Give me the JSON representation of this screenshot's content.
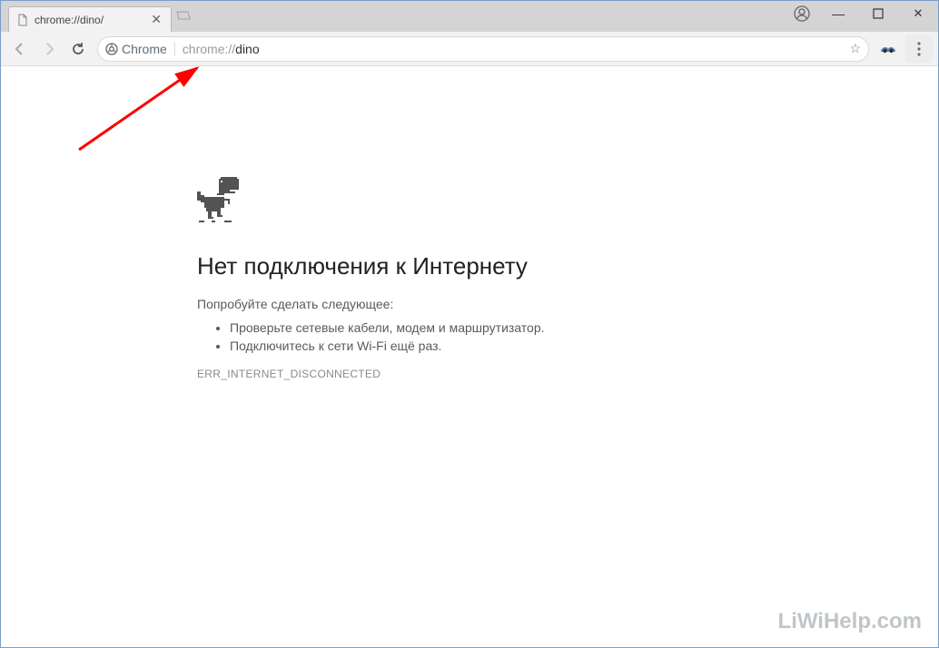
{
  "tab": {
    "title": "chrome://dino/"
  },
  "omnibox": {
    "origin_label": "Chrome",
    "url_scheme": "chrome://",
    "url_path": "dino"
  },
  "error": {
    "title": "Нет подключения к Интернету",
    "subtitle": "Попробуйте сделать следующее:",
    "suggestions": [
      "Проверьте сетевые кабели, модем и маршрутизатор.",
      "Подключитесь к сети Wi-Fi ещё раз."
    ],
    "code": "ERR_INTERNET_DISCONNECTED"
  },
  "watermark": "LiWiHelp.com",
  "icons": {
    "back": "←",
    "forward": "→",
    "reload": "⟳",
    "star": "☆",
    "close": "✕",
    "min": "—",
    "max": "▢"
  }
}
